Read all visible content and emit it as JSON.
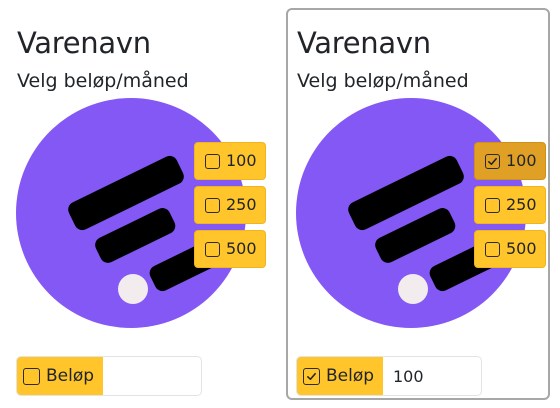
{
  "colors": {
    "accent": "#ffc52b",
    "accent_checked": "#e0a026",
    "logo_circle": "#8458f5",
    "logo_bars": "#000000",
    "logo_dot": "#f2ecef"
  },
  "products": [
    {
      "title": "Varenavn",
      "subtitle": "Velg beløp/måned",
      "logo_icon": "purple-circle-logo",
      "options": [
        {
          "label": "100",
          "checked": false
        },
        {
          "label": "250",
          "checked": false
        },
        {
          "label": "500",
          "checked": false
        }
      ],
      "custom_amount": {
        "label": "Beløp",
        "checked": false,
        "value": ""
      }
    },
    {
      "title": "Varenavn",
      "subtitle": "Velg beløp/måned",
      "logo_icon": "purple-circle-logo",
      "selected": true,
      "options": [
        {
          "label": "100",
          "checked": true
        },
        {
          "label": "250",
          "checked": false
        },
        {
          "label": "500",
          "checked": false
        }
      ],
      "custom_amount": {
        "label": "Beløp",
        "checked": true,
        "value": "100"
      }
    }
  ]
}
